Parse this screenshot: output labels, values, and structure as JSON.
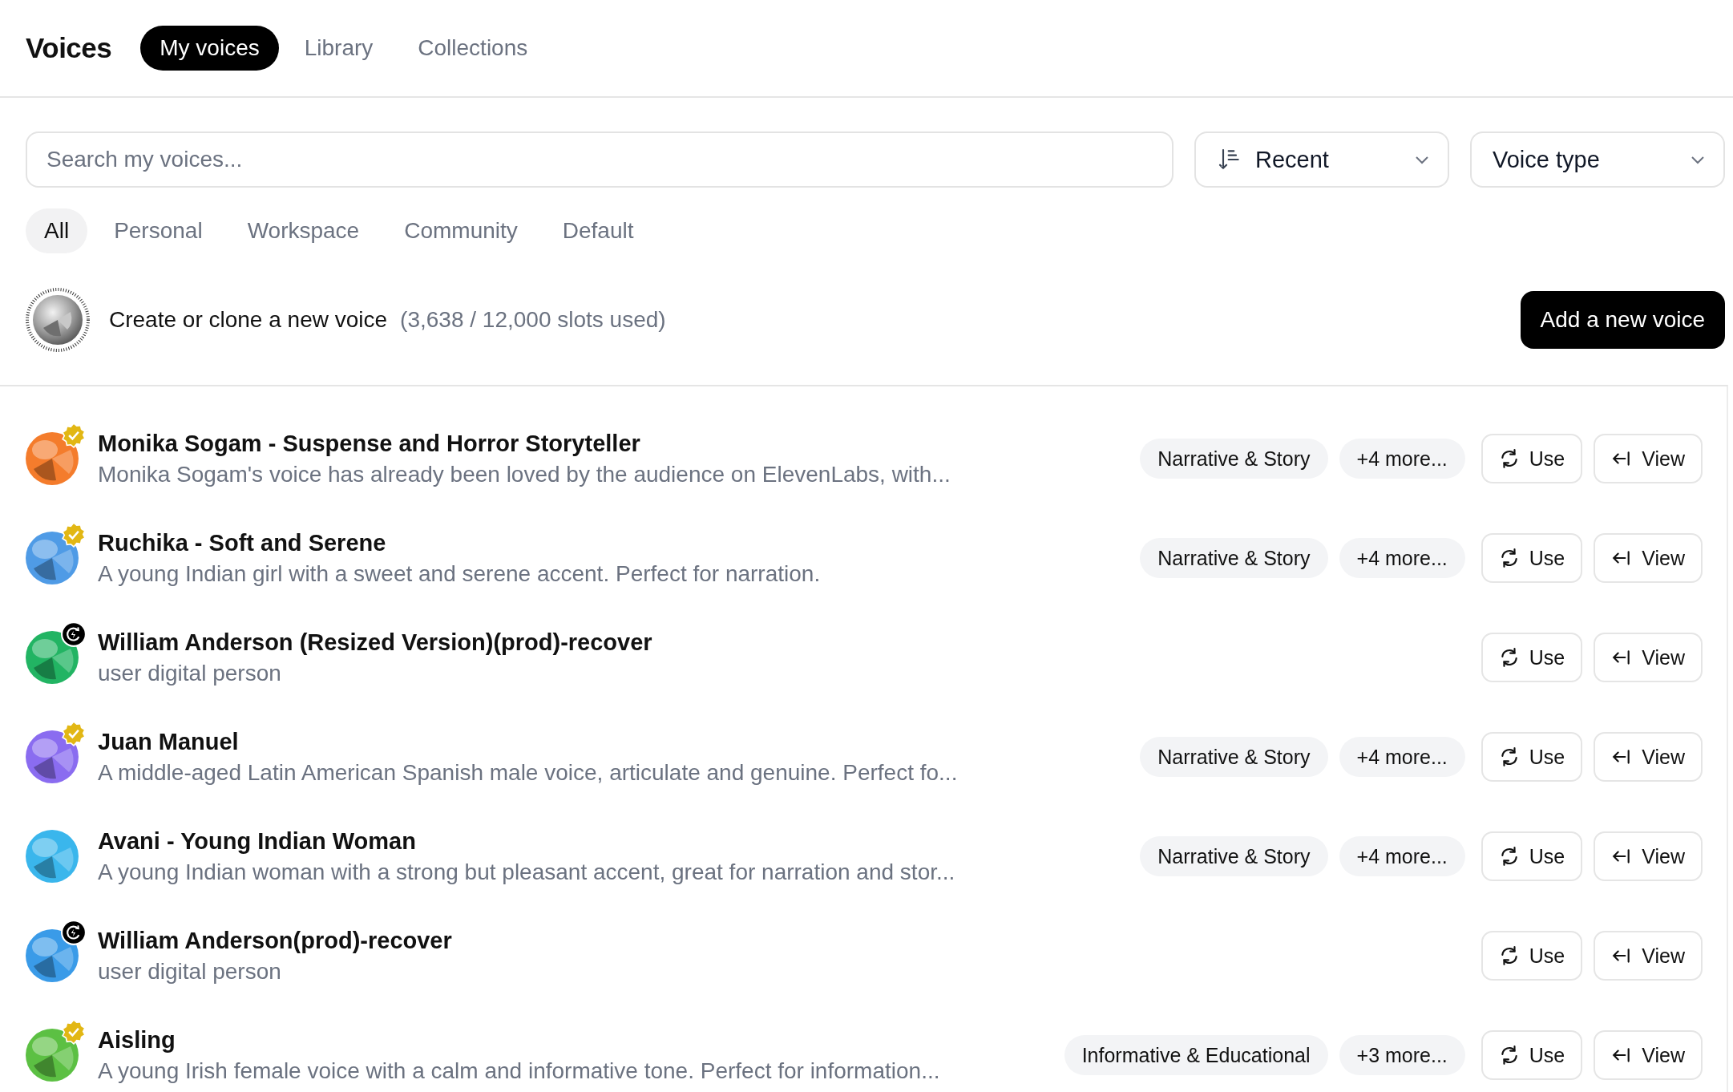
{
  "header": {
    "title": "Voices",
    "tabs": [
      {
        "label": "My voices",
        "selected": true
      },
      {
        "label": "Library",
        "selected": false
      },
      {
        "label": "Collections",
        "selected": false
      }
    ]
  },
  "search": {
    "placeholder": "Search my voices..."
  },
  "sort": {
    "value": "Recent"
  },
  "voice_type": {
    "label": "Voice type"
  },
  "filters": [
    {
      "label": "All",
      "selected": true
    },
    {
      "label": "Personal",
      "selected": false
    },
    {
      "label": "Workspace",
      "selected": false
    },
    {
      "label": "Community",
      "selected": false
    },
    {
      "label": "Default",
      "selected": false
    }
  ],
  "create": {
    "label": "Create or clone a new voice",
    "slots": "(3,638 / 12,000 slots used)",
    "button": "Add a new voice"
  },
  "voices": [
    {
      "name": "Monika Sogam - Suspense and Horror Storyteller",
      "description": "Monika Sogam's voice has already been loved by the audience on ElevenLabs, with...",
      "color": "#f47c2c",
      "verified": true,
      "cloned": false,
      "tags": [
        "Narrative & Story",
        "+4 more..."
      ],
      "use": "Use",
      "view": "View"
    },
    {
      "name": "Ruchika - Soft and Serene",
      "description": "A young Indian girl with a sweet and serene accent. Perfect for narration.",
      "color": "#4f9be6",
      "verified": true,
      "cloned": false,
      "tags": [
        "Narrative & Story",
        "+4 more..."
      ],
      "use": "Use",
      "view": "View"
    },
    {
      "name": "William Anderson (Resized Version)(prod)-recover",
      "description": "user digital person",
      "color": "#22b463",
      "verified": false,
      "cloned": true,
      "use": "Use",
      "view": "View"
    },
    {
      "name": "Juan Manuel",
      "description": "A middle-aged Latin American Spanish male voice, articulate and genuine. Perfect fo...",
      "color": "#8a6cf0",
      "verified": true,
      "cloned": false,
      "tags": [
        "Narrative & Story",
        "+4 more..."
      ],
      "use": "Use",
      "view": "View"
    },
    {
      "name": "Avani - Young Indian Woman",
      "description": "A young Indian woman with a strong but pleasant accent, great for narration and stor...",
      "color": "#3ab6ec",
      "verified": false,
      "cloned": false,
      "tags": [
        "Narrative & Story",
        "+4 more..."
      ],
      "use": "Use",
      "view": "View"
    },
    {
      "name": "William Anderson(prod)-recover",
      "description": "user digital person",
      "color": "#3a9be8",
      "verified": false,
      "cloned": true,
      "use": "Use",
      "view": "View"
    },
    {
      "name": "Aisling",
      "description": "A young Irish female voice with a calm and informative tone. Perfect for information...",
      "color": "#5cc043",
      "verified": true,
      "cloned": false,
      "tags": [
        "Informative & Educational",
        "+3 more..."
      ],
      "use": "Use",
      "view": "View"
    }
  ]
}
